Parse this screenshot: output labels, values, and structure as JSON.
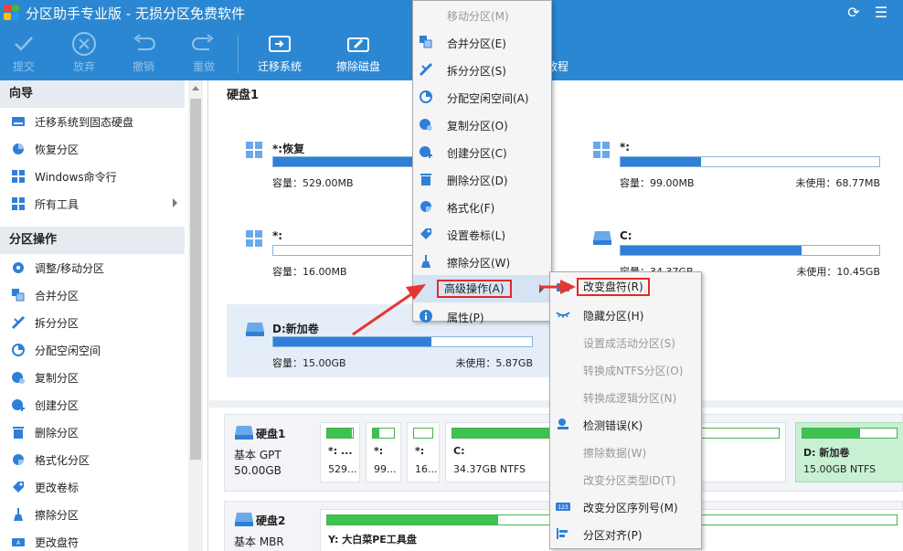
{
  "window": {
    "title": "分区助手专业版 - 无损分区免费软件",
    "colors": {
      "titlebar": "#2b87d1",
      "accent": "#2f7fd8",
      "partition_fill": "#3cc34f",
      "highlight_border": "#e02a2a"
    }
  },
  "toolbar": {
    "submit": "提交",
    "discard": "放弃",
    "undo": "撤销",
    "redo": "重做",
    "migrate": "迁移系统",
    "wipe": "擦除磁盘",
    "tutorial": "教程"
  },
  "sidebar": {
    "wizard_header": "向导",
    "wizard_items": [
      {
        "label": "迁移系统到固态硬盘",
        "icon": "disk-migrate-icon"
      },
      {
        "label": "恢复分区",
        "icon": "recover-icon"
      },
      {
        "label": "Windows命令行",
        "icon": "windows-icon"
      },
      {
        "label": "所有工具",
        "icon": "tools-grid-icon"
      }
    ],
    "ops_header": "分区操作",
    "ops_items": [
      {
        "label": "调整/移动分区",
        "icon": "resize-icon"
      },
      {
        "label": "合并分区",
        "icon": "merge-icon"
      },
      {
        "label": "拆分分区",
        "icon": "split-icon"
      },
      {
        "label": "分配空闲空间",
        "icon": "allocate-icon"
      },
      {
        "label": "复制分区",
        "icon": "copy-icon"
      },
      {
        "label": "创建分区",
        "icon": "create-icon"
      },
      {
        "label": "删除分区",
        "icon": "trash-icon"
      },
      {
        "label": "格式化分区",
        "icon": "format-icon"
      },
      {
        "label": "更改卷标",
        "icon": "tag-icon"
      },
      {
        "label": "擦除分区",
        "icon": "broom-icon"
      },
      {
        "label": "更改盘符",
        "icon": "drive-letter-icon"
      }
    ]
  },
  "disk1": {
    "title": "硬盘1",
    "partitions": [
      {
        "name": "*:恢复",
        "capacity": "容量：529.00MB",
        "free": "",
        "fill": 0.95
      },
      {
        "name": "*:",
        "capacity": "容量：99.00MB",
        "free": "未使用：68.77MB",
        "fill": 0.31
      },
      {
        "name": "*:",
        "capacity": "容量：16.00MB",
        "free": "",
        "fill": 0.0
      },
      {
        "name": "C:",
        "capacity": "容量：34.37GB",
        "free": "未使用：10.45GB",
        "fill": 0.7
      },
      {
        "name": "D:新加卷",
        "capacity": "容量：15.00GB",
        "free": "未使用：5.87GB",
        "fill": 0.61
      }
    ]
  },
  "disk_rows": [
    {
      "name": "硬盘1",
      "type": "基本 GPT",
      "size": "50.00GB",
      "blocks": [
        {
          "label": "*: ...",
          "sub": "529...",
          "fill": 0.95
        },
        {
          "label": "*:",
          "sub": "99...",
          "fill": 0.31
        },
        {
          "label": "*:",
          "sub": "16...",
          "fill": 0.0
        },
        {
          "label": "C:",
          "sub": "34.37GB NTFS",
          "fill": 0.7
        },
        {
          "label": "D: 新加卷",
          "sub": "15.00GB NTFS",
          "fill": 0.61
        }
      ]
    },
    {
      "name": "硬盘2",
      "type": "基本 MBR",
      "blocks": [
        {
          "label": "Y: 大白菜PE工具盘",
          "sub": "",
          "fill": 0.3
        }
      ]
    }
  ],
  "context_menu": [
    {
      "label": "移动分区(M)",
      "icon": "move-icon",
      "disabled": true
    },
    {
      "label": "合并分区(E)",
      "icon": "merge-icon",
      "disabled": false
    },
    {
      "label": "拆分分区(S)",
      "icon": "split-icon",
      "disabled": false
    },
    {
      "label": "分配空闲空间(A)",
      "icon": "allocate-icon",
      "disabled": false
    },
    {
      "label": "复制分区(O)",
      "icon": "copy-icon",
      "disabled": false
    },
    {
      "label": "创建分区(C)",
      "icon": "create-icon",
      "disabled": false
    },
    {
      "label": "删除分区(D)",
      "icon": "trash-icon",
      "disabled": false
    },
    {
      "label": "格式化(F)",
      "icon": "format-icon",
      "disabled": false
    },
    {
      "label": "设置卷标(L)",
      "icon": "tag-icon",
      "disabled": false
    },
    {
      "label": "擦除分区(W)",
      "icon": "broom-icon",
      "disabled": false
    },
    {
      "label": "高级操作(A)",
      "icon": "",
      "disabled": false,
      "highlight": true
    },
    {
      "label": "属性(P)",
      "icon": "info-icon",
      "disabled": false
    }
  ],
  "advanced_submenu": [
    {
      "label": "改变盘符(R)",
      "icon": "drive-letter-icon",
      "disabled": false,
      "highlight": true
    },
    {
      "label": "隐藏分区(H)",
      "icon": "eye-hide-icon",
      "disabled": false
    },
    {
      "label": "设置成活动分区(S)",
      "icon": "",
      "disabled": true
    },
    {
      "label": "转换成NTFS分区(O)",
      "icon": "",
      "disabled": true
    },
    {
      "label": "转换成逻辑分区(N)",
      "icon": "",
      "disabled": true
    },
    {
      "label": "检测错误(K)",
      "icon": "check-icon",
      "disabled": false
    },
    {
      "label": "擦除数据(W)",
      "icon": "",
      "disabled": true
    },
    {
      "label": "改变分区类型ID(T)",
      "icon": "",
      "disabled": true
    },
    {
      "label": "改变分区序列号(M)",
      "icon": "serial-icon",
      "disabled": false
    },
    {
      "label": "分区对齐(P)",
      "icon": "align-icon",
      "disabled": false
    }
  ]
}
